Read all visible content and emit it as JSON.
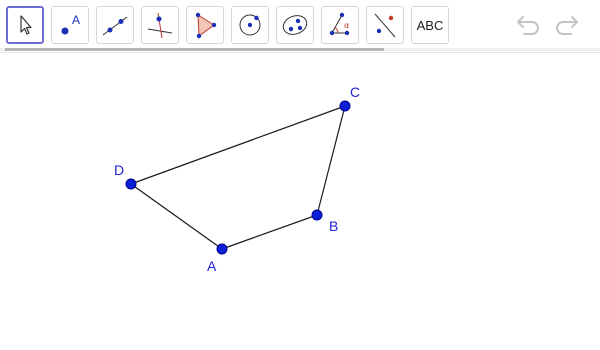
{
  "toolbar": {
    "tools": [
      {
        "name": "move-tool",
        "icon": "cursor-arrow-icon"
      },
      {
        "name": "point-tool",
        "icon": "point-icon",
        "glyph": "A"
      },
      {
        "name": "line-tool",
        "icon": "line-icon"
      },
      {
        "name": "perpendicular-line-tool",
        "icon": "perpendicular-line-icon"
      },
      {
        "name": "polygon-tool",
        "icon": "polygon-icon"
      },
      {
        "name": "circle-center-point-tool",
        "icon": "circle-icon"
      },
      {
        "name": "ellipse-tool",
        "icon": "ellipse-icon"
      },
      {
        "name": "angle-tool",
        "icon": "angle-icon",
        "glyph": "α"
      },
      {
        "name": "reflect-tool",
        "icon": "reflect-about-line-icon"
      },
      {
        "name": "text-tool",
        "icon": "text-icon",
        "label": "ABC"
      }
    ],
    "undo_icon": "undo-icon",
    "redo_icon": "redo-icon"
  },
  "colors": {
    "point_fill": "#0b1fd6",
    "label": "#1f1fd8",
    "segment": "#1a1a1a",
    "active_border": "#6c6cd1",
    "polygon_fill": "#f5c4b8"
  },
  "construction": {
    "points": [
      {
        "label": "A"
      },
      {
        "label": "B"
      },
      {
        "label": "C"
      },
      {
        "label": "D"
      }
    ],
    "polygon_order": [
      "A",
      "B",
      "C",
      "D"
    ]
  }
}
